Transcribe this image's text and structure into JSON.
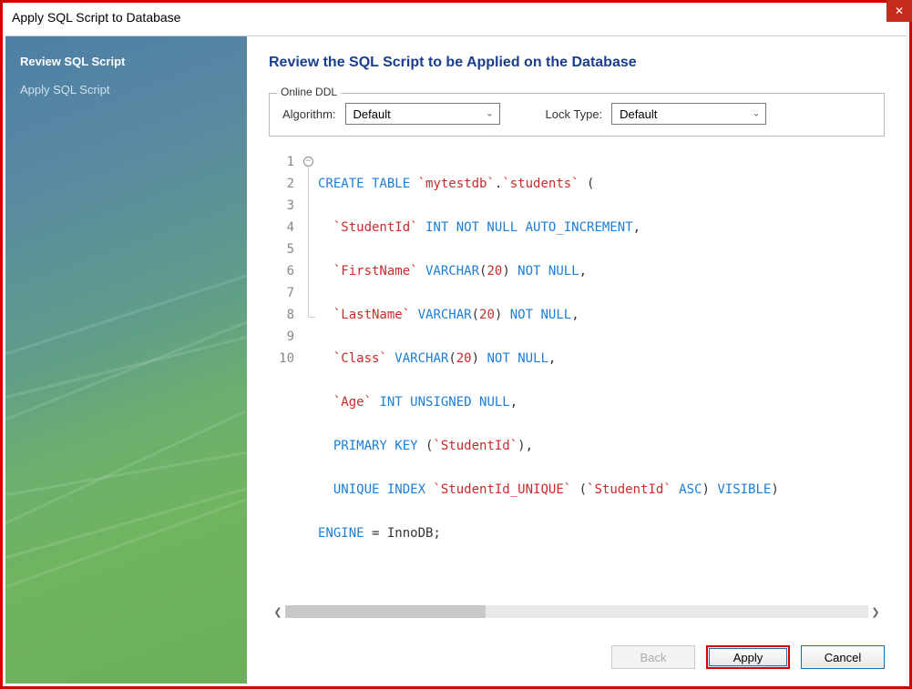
{
  "window": {
    "title": "Apply SQL Script to Database"
  },
  "sidebar": {
    "items": [
      {
        "label": "Review SQL Script",
        "active": true
      },
      {
        "label": "Apply SQL Script",
        "active": false
      }
    ]
  },
  "content": {
    "heading": "Review the SQL Script to be Applied on the Database",
    "online_ddl": {
      "legend": "Online DDL",
      "algorithm_label": "Algorithm:",
      "algorithm_value": "Default",
      "locktype_label": "Lock Type:",
      "locktype_value": "Default"
    },
    "code_lines": [
      "1",
      "2",
      "3",
      "4",
      "5",
      "6",
      "7",
      "8",
      "9",
      "10"
    ],
    "sql": {
      "l1": {
        "a": "CREATE TABLE",
        "b": "`mytestdb`",
        "c": ".",
        "d": "`students`",
        "e": " ("
      },
      "l2": {
        "a": "`StudentId`",
        "b": " INT NOT NULL AUTO_INCREMENT",
        "c": ","
      },
      "l3": {
        "a": "`FirstName`",
        "b": " VARCHAR",
        "c": "(",
        "d": "20",
        "e": ")",
        "f": " NOT NULL",
        "g": ","
      },
      "l4": {
        "a": "`LastName`",
        "b": " VARCHAR",
        "c": "(",
        "d": "20",
        "e": ")",
        "f": " NOT NULL",
        "g": ","
      },
      "l5": {
        "a": "`Class`",
        "b": " VARCHAR",
        "c": "(",
        "d": "20",
        "e": ")",
        "f": " NOT NULL",
        "g": ","
      },
      "l6": {
        "a": "`Age`",
        "b": " INT UNSIGNED NULL",
        "c": ","
      },
      "l7": {
        "a": "PRIMARY KEY",
        "b": " (",
        "c": "`StudentId`",
        "d": "),"
      },
      "l8": {
        "a": "UNIQUE INDEX",
        "b": " ",
        "c": "`StudentId_UNIQUE`",
        "d": " (",
        "e": "`StudentId`",
        "f": " ASC",
        "g": ")",
        "h": " VISIBLE",
        "i": ")"
      },
      "l9": {
        "a": "ENGINE",
        "b": " = InnoDB;"
      }
    }
  },
  "buttons": {
    "back": "Back",
    "apply": "Apply",
    "cancel": "Cancel"
  }
}
